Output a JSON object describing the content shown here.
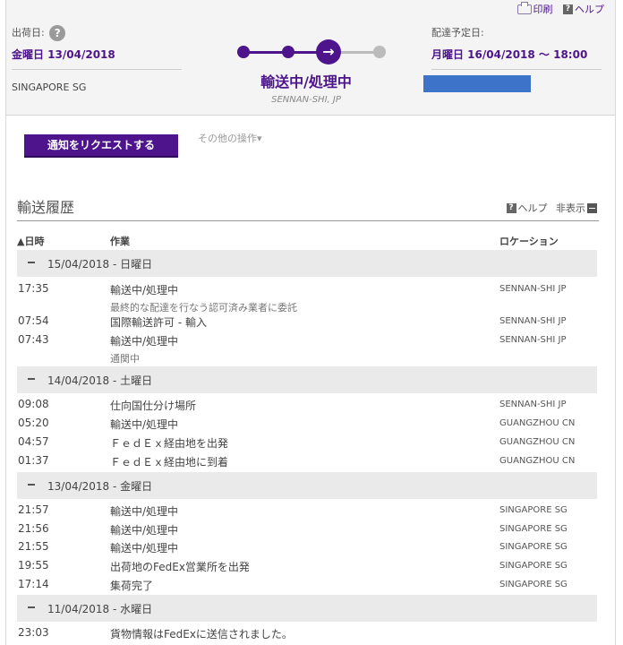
{
  "toplinks": {
    "print": "印刷",
    "help": "ヘルプ"
  },
  "shipment": {
    "ship_label": "出荷日:",
    "ship_date": "金曜日 13/04/2018",
    "origin": "SINGAPORE SG",
    "status": "輸送中/処理中",
    "status_location": "SENNAN-SHI, JP",
    "delivery_label": "配達予定日:",
    "delivery_date": "月曜日 16/04/2018 〜 18:00"
  },
  "actions": {
    "notify_button": "通知をリクエストする",
    "more_actions": "その他の操作▾"
  },
  "history": {
    "title": "輸送履歴",
    "help": "ヘルプ",
    "hide": "非表示",
    "columns": {
      "date": "▲日時",
      "activity": "作業",
      "location": "ロケーション"
    },
    "groups": [
      {
        "date": "15/04/2018 - 日曜日",
        "rows": [
          {
            "time": "17:35",
            "activity": "輸送中/処理中",
            "detail": "最終的な配達を行なう認可済み業者に委託",
            "location": "SENNAN-SHI JP"
          },
          {
            "time": "07:54",
            "activity": "国際輸送許可 - 輸入",
            "location": "SENNAN-SHI JP"
          },
          {
            "time": "07:43",
            "activity": "輸送中/処理中",
            "detail": "通関中",
            "location": "SENNAN-SHI JP"
          }
        ]
      },
      {
        "date": "14/04/2018 - 土曜日",
        "rows": [
          {
            "time": "09:08",
            "activity": "仕向国仕分け場所",
            "location": "SENNAN-SHI JP"
          },
          {
            "time": "05:20",
            "activity": "輸送中/処理中",
            "location": "GUANGZHOU CN"
          },
          {
            "time": "04:57",
            "activity": "ＦｅｄＥｘ経由地を出発",
            "location": "GUANGZHOU CN"
          },
          {
            "time": "01:37",
            "activity": "ＦｅｄＥｘ経由地に到着",
            "location": "GUANGZHOU CN"
          }
        ]
      },
      {
        "date": "13/04/2018 - 金曜日",
        "rows": [
          {
            "time": "21:57",
            "activity": "輸送中/処理中",
            "location": "SINGAPORE SG"
          },
          {
            "time": "21:56",
            "activity": "輸送中/処理中",
            "location": "SINGAPORE SG"
          },
          {
            "time": "21:55",
            "activity": "輸送中/処理中",
            "location": "SINGAPORE SG"
          },
          {
            "time": "19:55",
            "activity": "出荷地のFedEx営業所を出発",
            "location": "SINGAPORE SG"
          },
          {
            "time": "17:14",
            "activity": "集荷完了",
            "location": "SINGAPORE SG"
          }
        ]
      },
      {
        "date": "11/04/2018 - 水曜日",
        "rows": [
          {
            "time": "23:03",
            "activity": "貨物情報はFedExに送信されました。"
          }
        ]
      }
    ]
  },
  "colors": {
    "brand": "#4d148c",
    "progress_pending": "#bbbbbb"
  },
  "icons": [
    "print-icon",
    "help-icon",
    "question-circle-icon",
    "arrow-right-icon",
    "collapse-icon",
    "minus-icon"
  ]
}
